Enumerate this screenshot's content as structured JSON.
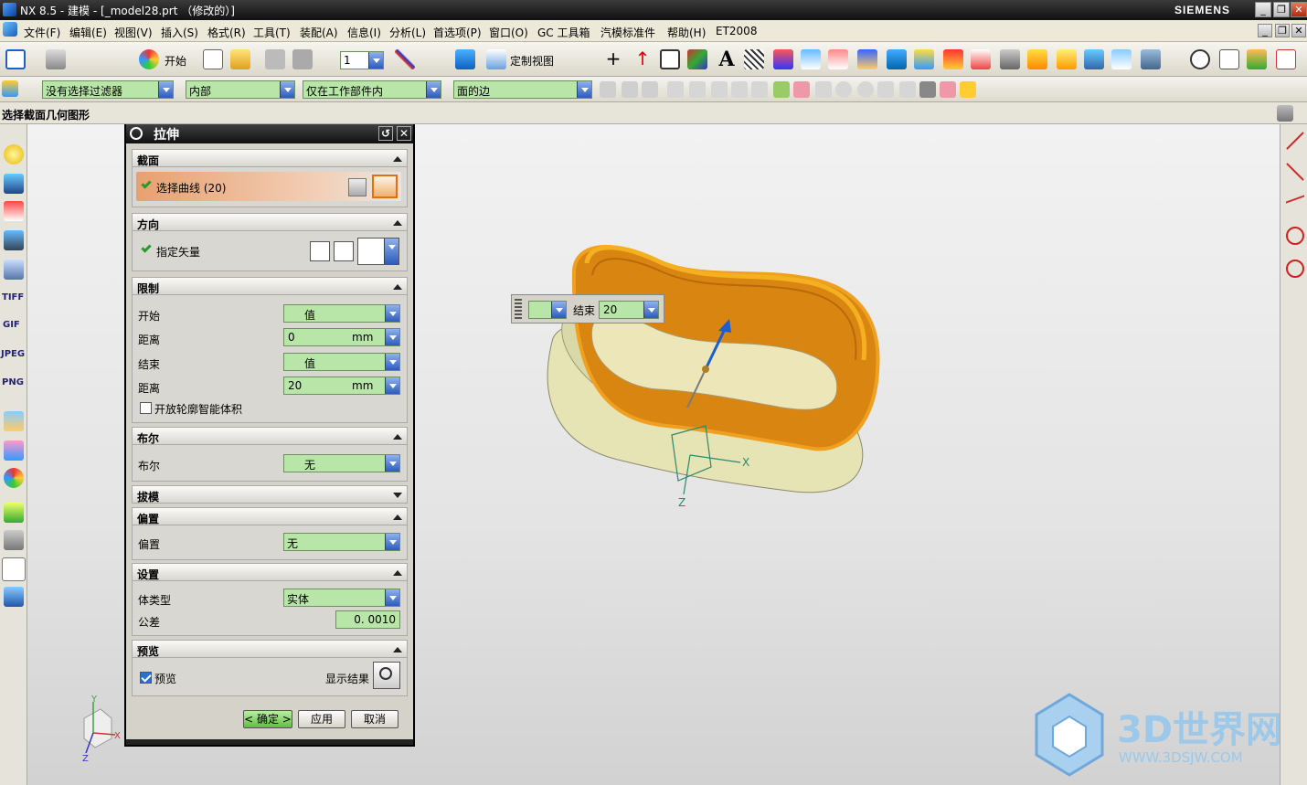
{
  "window": {
    "title": "NX 8.5 - 建模 - [_model28.prt （修改的）]",
    "brand": "SIEMENS",
    "min": "_",
    "restore": "❐",
    "close": "✕"
  },
  "menu": [
    "文件(F)",
    "编辑(E)",
    "视图(V)",
    "插入(S)",
    "格式(R)",
    "工具(T)",
    "装配(A)",
    "信息(I)",
    "分析(L)",
    "首选项(P)",
    "窗口(O)",
    "GC 工具箱",
    "汽模标准件",
    "帮助(H)",
    "ET2008"
  ],
  "toolbar": {
    "start_label": "开始",
    "layer_value": "1",
    "custom_view_label": "定制视图"
  },
  "filterbar": {
    "filter": "没有选择过滤器",
    "scope": "内部",
    "assembly": "仅在工作部件内",
    "curve_rule": "面的边"
  },
  "cue": "选择截面几何图形",
  "leftbar_labels": [
    "TIFF",
    "GIF",
    "JPEG",
    "PNG"
  ],
  "dialog": {
    "title": "拉伸",
    "section": {
      "header": "截面",
      "select_curve": "选择曲线 (20)"
    },
    "direction": {
      "header": "方向",
      "specify_vector": "指定矢量"
    },
    "limits": {
      "header": "限制",
      "start_label": "开始",
      "start_value": "值",
      "dist1_label": "距离",
      "dist1_value": "0",
      "unit": "mm",
      "end_label": "结束",
      "end_value": "值",
      "dist2_label": "距离",
      "dist2_value": "20",
      "open_profile": "开放轮廓智能体积"
    },
    "boolean": {
      "header": "布尔",
      "label": "布尔",
      "value": "无"
    },
    "draft": {
      "header": "拔模"
    },
    "offset": {
      "header": "偏置",
      "label": "偏置",
      "value": "无"
    },
    "settings": {
      "header": "设置",
      "body_type_label": "体类型",
      "body_type_value": "实体",
      "tolerance_label": "公差",
      "tolerance_value": "0. 0010"
    },
    "preview": {
      "header": "预览",
      "checkbox": "预览",
      "show_result": "显示结果"
    },
    "ok": "< 确定 >",
    "apply": "应用",
    "cancel": "取消"
  },
  "onscreen": {
    "end_label": "结束",
    "end_value": "20"
  },
  "axes": {
    "x": "X",
    "y": "Y",
    "z": "Z"
  },
  "watermark": {
    "name": "3D世界网",
    "url": "WWW.3DSJW.COM"
  },
  "colors": {
    "field_green": "#b8e6a8",
    "solid_orange": "#e08a10",
    "body_yellow": "#e6e4b4"
  }
}
